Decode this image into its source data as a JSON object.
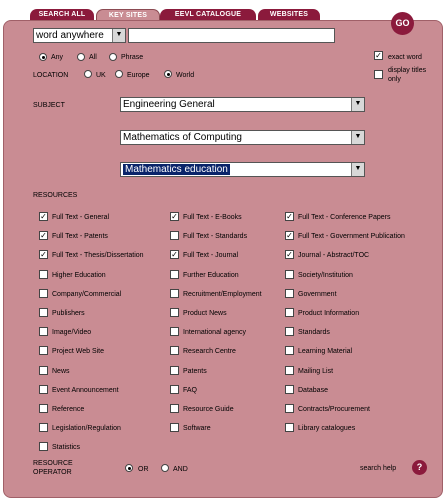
{
  "tabs": [
    "SEARCH ALL",
    "KEY SITES",
    "EEVL CATALOGUE",
    "WEBSITES"
  ],
  "search": {
    "field_value": "word anywhere",
    "query": ""
  },
  "go_label": "GO",
  "match": {
    "options": [
      "Any",
      "All",
      "Phrase"
    ],
    "selected": "Any"
  },
  "exact_word": {
    "label": "exact word",
    "checked": true
  },
  "display_titles": {
    "label": "display titles only",
    "checked": false
  },
  "location": {
    "label": "LOCATION",
    "options": [
      "UK",
      "Europe",
      "World"
    ],
    "selected": "World"
  },
  "subject": {
    "label": "SUBJECT",
    "level1": "Engineering General",
    "level2": "Mathematics of Computing",
    "level3": "Mathematics education"
  },
  "resources": {
    "label": "RESOURCES",
    "col1": [
      {
        "label": "Full Text - General",
        "checked": true
      },
      {
        "label": "Full Text - Patents",
        "checked": true
      },
      {
        "label": "Full Text - Thesis/Dissertation",
        "checked": true
      },
      {
        "label": "Higher Education",
        "checked": false
      },
      {
        "label": "Company/Commercial",
        "checked": false
      },
      {
        "label": "Publishers",
        "checked": false
      },
      {
        "label": "Image/Video",
        "checked": false
      },
      {
        "label": "Project Web Site",
        "checked": false
      },
      {
        "label": "News",
        "checked": false
      },
      {
        "label": "Event Announcement",
        "checked": false
      },
      {
        "label": "Reference",
        "checked": false
      },
      {
        "label": "Legislation/Regulation",
        "checked": false
      },
      {
        "label": "Statistics",
        "checked": false
      }
    ],
    "col2": [
      {
        "label": "Full Text - E-Books",
        "checked": true
      },
      {
        "label": "Full Text - Standards",
        "checked": false
      },
      {
        "label": "Full Text - Journal",
        "checked": true
      },
      {
        "label": "Further Education",
        "checked": false
      },
      {
        "label": "Recruitment/Employment",
        "checked": false
      },
      {
        "label": "Product News",
        "checked": false
      },
      {
        "label": "International agency",
        "checked": false
      },
      {
        "label": "Research Centre",
        "checked": false
      },
      {
        "label": "Patents",
        "checked": false
      },
      {
        "label": "FAQ",
        "checked": false
      },
      {
        "label": "Resource Guide",
        "checked": false
      },
      {
        "label": "Software",
        "checked": false
      }
    ],
    "col3": [
      {
        "label": "Full Text - Conference Papers",
        "checked": true
      },
      {
        "label": "Full Text - Government Publication",
        "checked": true
      },
      {
        "label": "Journal - Abstract/TOC",
        "checked": true
      },
      {
        "label": "Society/Institution",
        "checked": false
      },
      {
        "label": "Government",
        "checked": false
      },
      {
        "label": "Product Information",
        "checked": false
      },
      {
        "label": "Standards",
        "checked": false
      },
      {
        "label": "Learning Material",
        "checked": false
      },
      {
        "label": "Mailing List",
        "checked": false
      },
      {
        "label": "Database",
        "checked": false
      },
      {
        "label": "Contracts/Procurement",
        "checked": false
      },
      {
        "label": "Library catalogues",
        "checked": false
      }
    ]
  },
  "operator": {
    "label_line1": "RESOURCE",
    "label_line2": "OPERATOR",
    "options": [
      "OR",
      "AND"
    ],
    "selected": "OR"
  },
  "search_help": "search help",
  "help_icon": "?"
}
